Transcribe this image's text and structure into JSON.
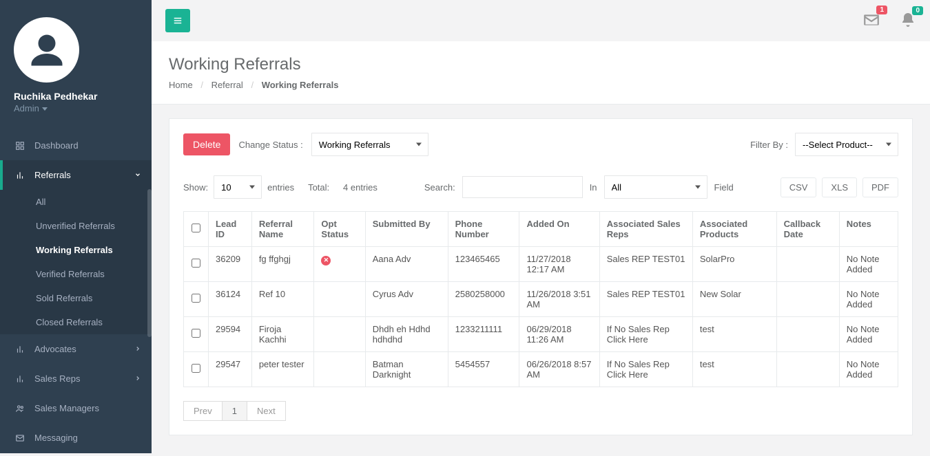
{
  "user": {
    "name": "Ruchika Pedhekar",
    "role": "Admin"
  },
  "nav": {
    "dashboard": "Dashboard",
    "referrals": "Referrals",
    "referrals_sub": {
      "all": "All",
      "unverified": "Unverified Referrals",
      "working": "Working Referrals",
      "verified": "Verified Referrals",
      "sold": "Sold Referrals",
      "closed": "Closed Referrals"
    },
    "advocates": "Advocates",
    "salesreps": "Sales Reps",
    "salesmanagers": "Sales Managers",
    "messaging": "Messaging"
  },
  "topbar": {
    "mail_badge": "1",
    "bell_badge": "0"
  },
  "page": {
    "title": "Working Referrals",
    "breadcrumb": {
      "home": "Home",
      "referral": "Referral",
      "current": "Working Referrals"
    }
  },
  "toolbar": {
    "delete": "Delete",
    "change_status_label": "Change Status :",
    "change_status_value": "Working Referrals",
    "filter_by_label": "Filter By :",
    "filter_by_value": "--Select Product--"
  },
  "controls": {
    "show_label": "Show:",
    "show_value": "10",
    "entries_label": "entries",
    "total_label": "Total:",
    "total_value": "4 entries",
    "search_label": "Search:",
    "in_label": "In",
    "in_value": "All",
    "field_label": "Field",
    "csv": "CSV",
    "xls": "XLS",
    "pdf": "PDF"
  },
  "table": {
    "headers": {
      "lead_id": "Lead ID",
      "referral_name": "Referral Name",
      "opt_status": "Opt Status",
      "submitted_by": "Submitted By",
      "phone": "Phone Number",
      "added_on": "Added On",
      "sales_reps": "Associated Sales Reps",
      "products": "Associated Products",
      "callback": "Callback Date",
      "notes": "Notes"
    },
    "rows": [
      {
        "lead_id": "36209",
        "referral_name": "fg ffghgj",
        "opt_status": "x",
        "submitted_by": "Aana Adv",
        "phone": "123465465",
        "added_on": "11/27/2018 12:17 AM",
        "sales_reps": "Sales REP TEST01",
        "products": "SolarPro",
        "callback": "",
        "notes": "No Note Added"
      },
      {
        "lead_id": "36124",
        "referral_name": "Ref 10",
        "opt_status": "",
        "submitted_by": "Cyrus Adv",
        "phone": "2580258000",
        "added_on": "11/26/2018 3:51 AM",
        "sales_reps": "Sales REP TEST01",
        "products": "New Solar",
        "callback": "",
        "notes": "No Note Added"
      },
      {
        "lead_id": "29594",
        "referral_name": "Firoja Kachhi",
        "opt_status": "",
        "submitted_by": "Dhdh eh Hdhd hdhdhd",
        "phone": "1233211111",
        "added_on": "06/29/2018 11:26 AM",
        "sales_reps": "If No Sales Rep Click Here",
        "products": "test",
        "callback": "",
        "notes": "No Note Added"
      },
      {
        "lead_id": "29547",
        "referral_name": "peter tester",
        "opt_status": "",
        "submitted_by": "Batman Darknight",
        "phone": "5454557",
        "added_on": "06/26/2018 8:57 AM",
        "sales_reps": "If No Sales Rep Click Here",
        "products": "test",
        "callback": "",
        "notes": "No Note Added"
      }
    ]
  },
  "pager": {
    "prev": "Prev",
    "page1": "1",
    "next": "Next"
  }
}
